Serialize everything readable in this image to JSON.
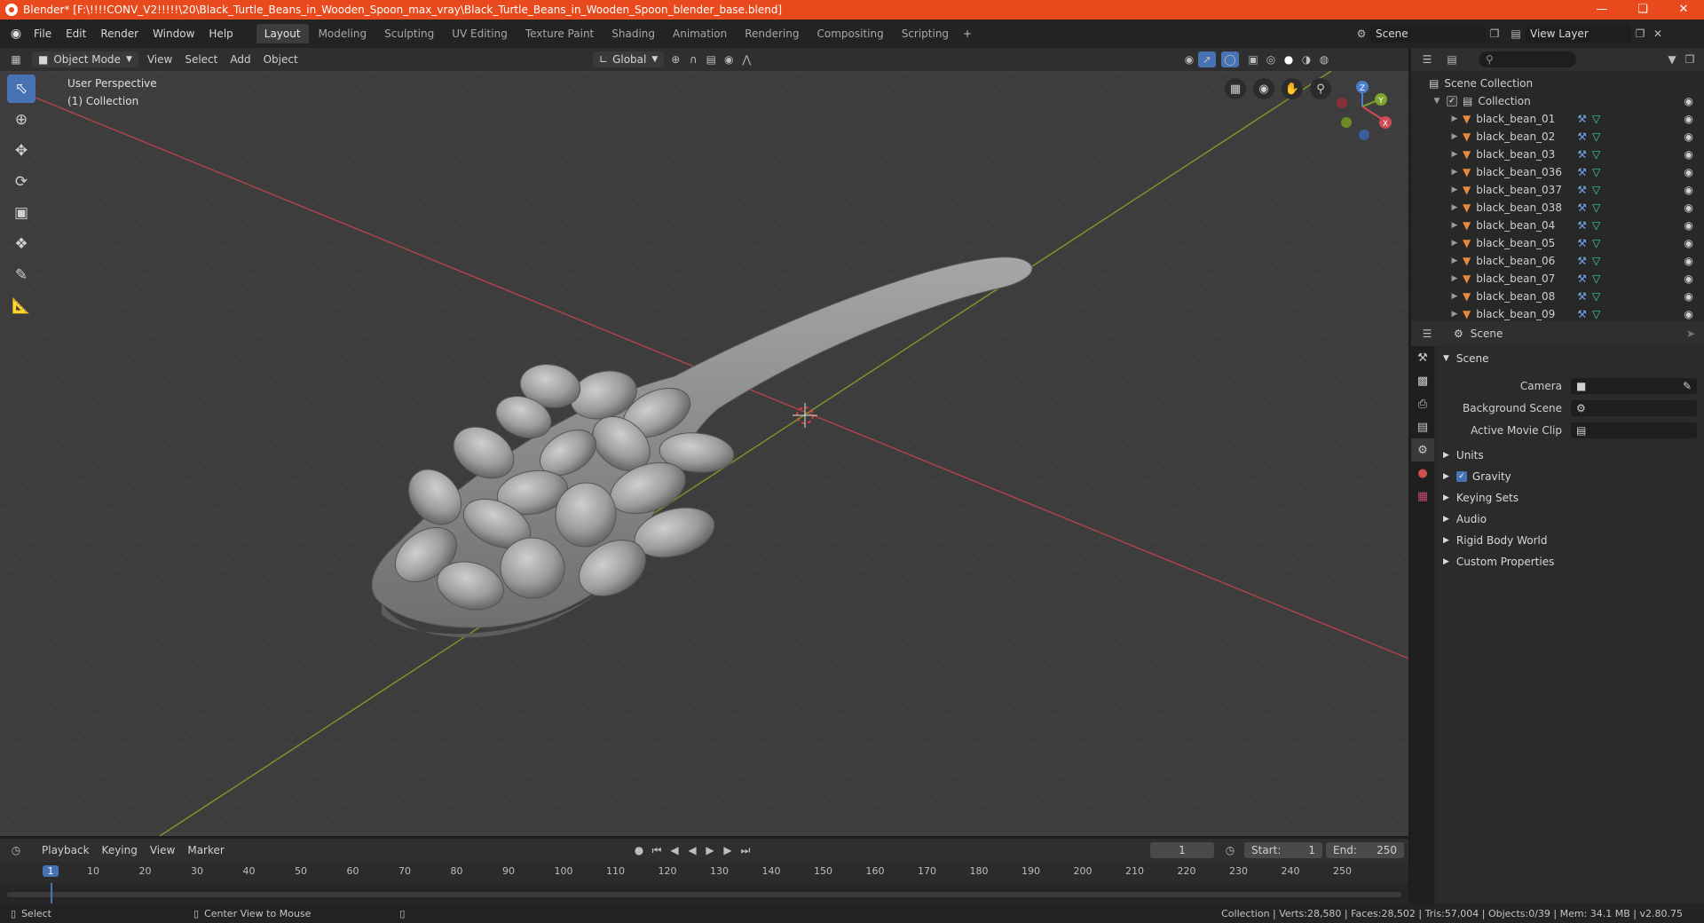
{
  "title": "Blender* [F:\\!!!!CONV_V2!!!!!\\20\\Black_Turtle_Beans_in_Wooden_Spoon_max_vray\\Black_Turtle_Beans_in_Wooden_Spoon_blender_base.blend]",
  "menu": [
    "File",
    "Edit",
    "Render",
    "Window",
    "Help"
  ],
  "workspaces": [
    "Layout",
    "Modeling",
    "Sculpting",
    "UV Editing",
    "Texture Paint",
    "Shading",
    "Animation",
    "Rendering",
    "Compositing",
    "Scripting"
  ],
  "active_workspace": "Layout",
  "scene_name": "Scene",
  "view_layer": "View Layer",
  "viewport_header": {
    "mode": "Object Mode",
    "menus": [
      "View",
      "Select",
      "Add",
      "Object"
    ],
    "orientation": "Global"
  },
  "viewport_label": {
    "line1": "User Perspective",
    "line2": "(1) Collection"
  },
  "gizmo": {
    "x": "X",
    "y": "Y",
    "z": "Z"
  },
  "outliner": {
    "root": "Scene Collection",
    "collection": "Collection",
    "objects": [
      "black_bean_01",
      "black_bean_02",
      "black_bean_03",
      "black_bean_036",
      "black_bean_037",
      "black_bean_038",
      "black_bean_04",
      "black_bean_05",
      "black_bean_06",
      "black_bean_07",
      "black_bean_08",
      "black_bean_09"
    ]
  },
  "properties": {
    "context": "Scene",
    "section": "Scene",
    "fields": [
      {
        "label": "Camera",
        "value": ""
      },
      {
        "label": "Background Scene",
        "value": ""
      },
      {
        "label": "Active Movie Clip",
        "value": ""
      }
    ],
    "subsections": [
      "Units",
      "Gravity",
      "Keying Sets",
      "Audio",
      "Rigid Body World",
      "Custom Properties"
    ]
  },
  "timeline": {
    "menus": [
      "Playback",
      "Keying",
      "View",
      "Marker"
    ],
    "current_frame": "1",
    "start_label": "Start:",
    "start": "1",
    "end_label": "End:",
    "end": "250",
    "ticks": [
      "1",
      "10",
      "20",
      "30",
      "40",
      "50",
      "60",
      "70",
      "80",
      "90",
      "100",
      "110",
      "120",
      "130",
      "140",
      "150",
      "160",
      "170",
      "180",
      "190",
      "200",
      "210",
      "220",
      "230",
      "240",
      "250"
    ]
  },
  "statusbar": {
    "left1": "Select",
    "left2": "Center View to Mouse",
    "right": "Collection | Verts:28,580 | Faces:28,502 | Tris:57,004 | Objects:0/39 | Mem: 34.1 MB | v2.80.75"
  },
  "colors": {
    "accent": "#4772b3",
    "titlebar": "#e8491d",
    "x_axis": "#b3424c",
    "y_axis": "#7a9a2a"
  }
}
